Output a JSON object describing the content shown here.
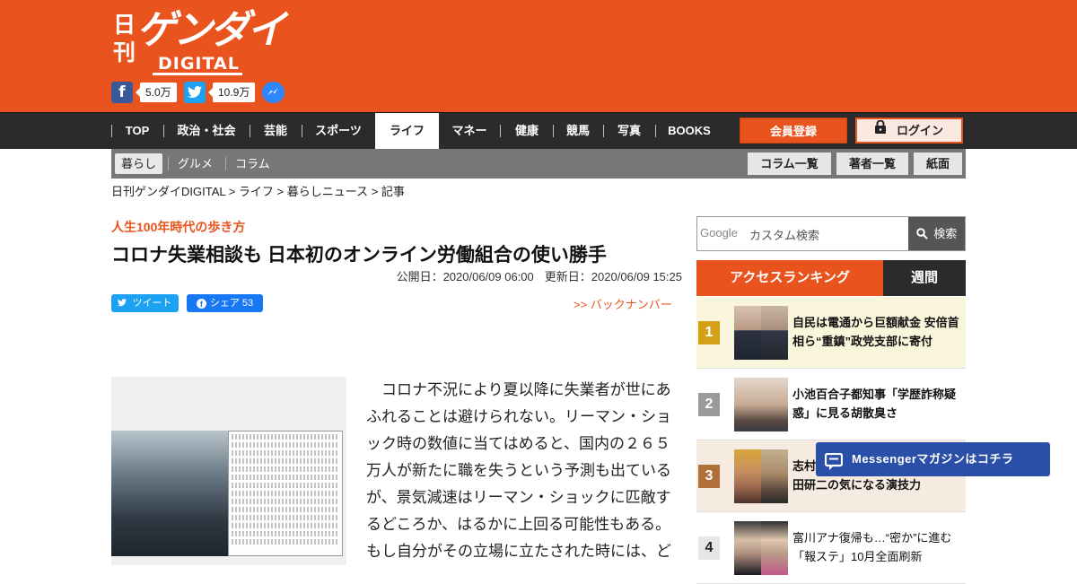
{
  "brand": {
    "logo_kanji": "日刊",
    "logo_name": "ゲンダイ",
    "logo_sub": "DIGITAL"
  },
  "social": {
    "facebook_count": "5.0万",
    "twitter_count": "10.9万"
  },
  "nav": {
    "items": [
      "TOP",
      "政治・社会",
      "芸能",
      "スポーツ",
      "ライフ",
      "マネー",
      "健康",
      "競馬",
      "写真",
      "BOOKS"
    ],
    "active_index": 4,
    "register": "会員登録",
    "login": "ログイン"
  },
  "subnav": {
    "items": [
      "暮らし",
      "グルメ",
      "コラム"
    ],
    "active_index": 0,
    "buttons": [
      "コラム一覧",
      "著者一覧",
      "紙面"
    ]
  },
  "breadcrumb": "日刊ゲンダイDIGITAL > ライフ > 暮らしニュース > 記事",
  "article": {
    "kicker": "人生100年時代の歩き方",
    "title": "コロナ失業相談も 日本初のオンライン労働組合の使い勝手",
    "published": "公開日：2020/06/09 06:00",
    "updated": "更新日：2020/06/09 15:25",
    "tweet": "ツイート",
    "share": "シェア 53",
    "back_numbers": ">> バックナンバー",
    "body": "　コロナ不況により夏以降に失業者が世にあふれることは避けられない。リーマン・ショック時の数値に当てはめると、国内の２６５万人が新たに職を失うという予測も出ているが、景気減速はリーマン・ショックに匹敵するどころか、はるかに上回る可能性もある。もし自分がその立場に立たされた時には、ど"
  },
  "sidebar": {
    "search_google": "Google",
    "search_placeholder": "カスタム検索",
    "search_button": "検索",
    "ranking_title": "アクセスランキング",
    "ranking_period": "週間",
    "rankings": [
      {
        "rank": "1",
        "title": "自民は電通から巨額献金 安倍首相ら“重鎮”政党支部に寄付"
      },
      {
        "rank": "2",
        "title": "小池百合子都知事「学歴詐称疑惑」に見る胡散臭さ"
      },
      {
        "rank": "3",
        "title": "志村けんさん追悼番組で光った 田研二の気になる演技力"
      },
      {
        "rank": "4",
        "title": "富川アナ復帰も…“密か”に進む「報ステ」10月全面刷新"
      }
    ],
    "messenger_label": "Messengerマガジンはコチラ"
  },
  "colors": {
    "brand_orange": "#e9541e",
    "nav_dark": "#2b2b2b",
    "rank_gold": "#d4a017",
    "rank_silver": "#9a9a9a",
    "rank_bronze": "#b0703a",
    "messenger_blue": "#2a4fa8"
  },
  "icons": [
    "facebook-icon",
    "twitter-icon",
    "messenger-icon",
    "lock-icon",
    "search-icon",
    "chat-icon"
  ]
}
